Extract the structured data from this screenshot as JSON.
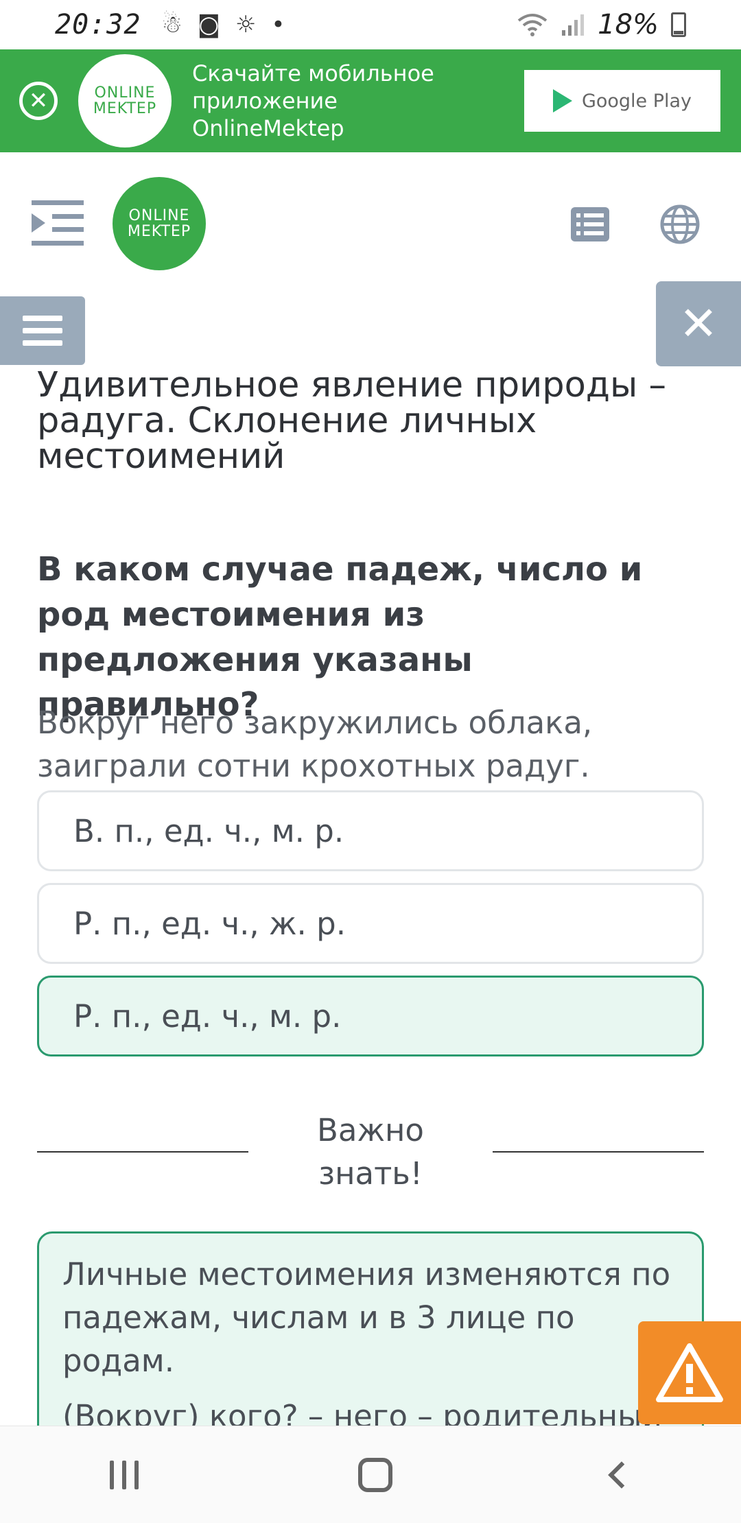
{
  "status_bar": {
    "time": "20:32",
    "icons": [
      "notification-icon",
      "camera-icon",
      "weather-icon",
      "dot-icon"
    ],
    "battery": "18%"
  },
  "banner": {
    "logo_line1": "ONLINE",
    "logo_line2": "MEKTEP",
    "text_line1": "Скачайте мобильное",
    "text_line2": "приложение OnlineMektep",
    "store_label": "Google Play"
  },
  "header": {
    "logo_line1": "ONLINE",
    "logo_line2": "MEKTEP"
  },
  "lesson": {
    "title": "Удивительное явление природы – радуга. Склонение личных местоимений"
  },
  "question": {
    "text": "В каком случае падеж, число и род местоимения из предложения указаны правильно?",
    "sentence": "Вокруг него закружились облака, заиграли сотни крохотных радуг.",
    "options": [
      {
        "label": "В. п., ед. ч., м. р.",
        "selected": false
      },
      {
        "label": "Р. п., ед. ч., ж. р.",
        "selected": false
      },
      {
        "label": "Р. п., ед. ч., м. р.",
        "selected": true
      }
    ]
  },
  "important": {
    "line1": "Важно",
    "line2": "знать!"
  },
  "info": {
    "paragraph1": "Личные местоимения изменяются по падежам, числам и в 3 лице по родам.",
    "paragraph2": "(Вокруг) кого? – него – родительный"
  },
  "colors": {
    "brand_green": "#3aaa4a",
    "selected_border": "#2a9a6e",
    "selected_bg": "#e8f7f1",
    "side_button": "#9aaaba",
    "alert": "#f28c28"
  }
}
